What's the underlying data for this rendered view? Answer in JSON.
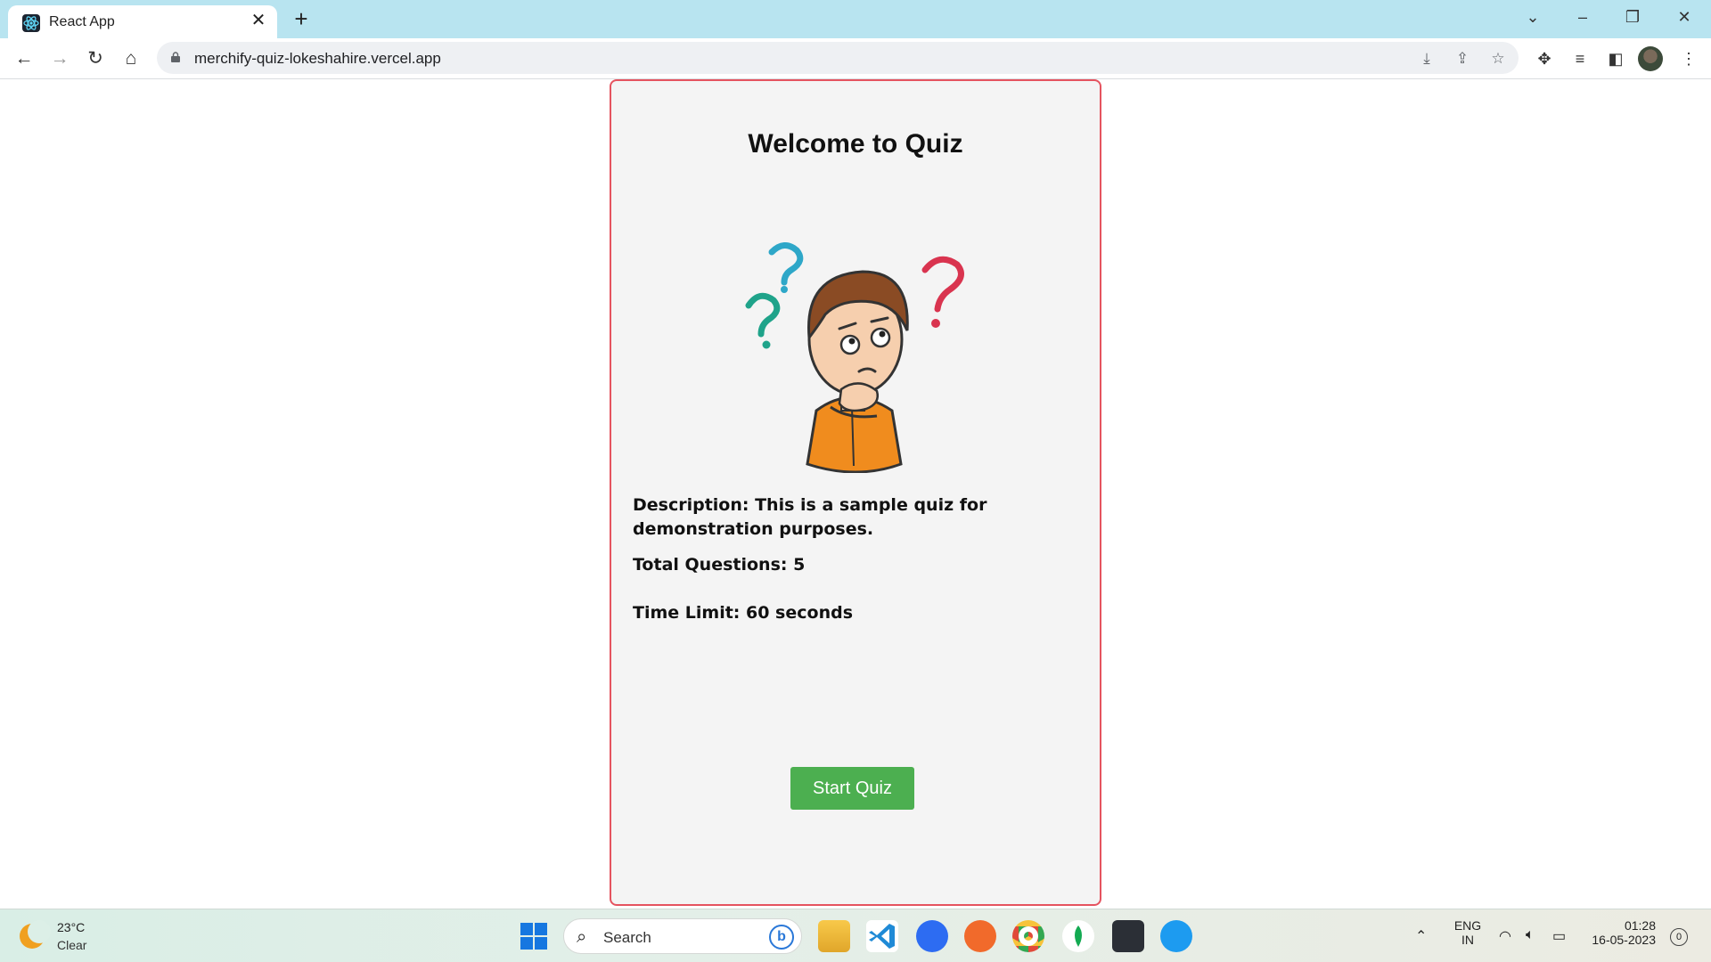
{
  "browser": {
    "tab_title": "React App",
    "url": "merchify-quiz-lokeshahire.vercel.app"
  },
  "quiz": {
    "title": "Welcome to Quiz",
    "description": "Description: This is a sample quiz for demonstration purposes.",
    "total_questions": "Total Questions: 5",
    "time_limit": "Time Limit: 60 seconds",
    "start_button": "Start Quiz"
  },
  "taskbar": {
    "weather_temp": "23°C",
    "weather_condition": "Clear",
    "search_label": "Search",
    "lang_primary": "ENG",
    "lang_secondary": "IN",
    "time": "01:28",
    "date": "16-05-2023",
    "notification_count": "0"
  },
  "colors": {
    "card_border": "#e5535f",
    "start_button": "#4caf50",
    "tabstrip": "#b8e4f0"
  }
}
